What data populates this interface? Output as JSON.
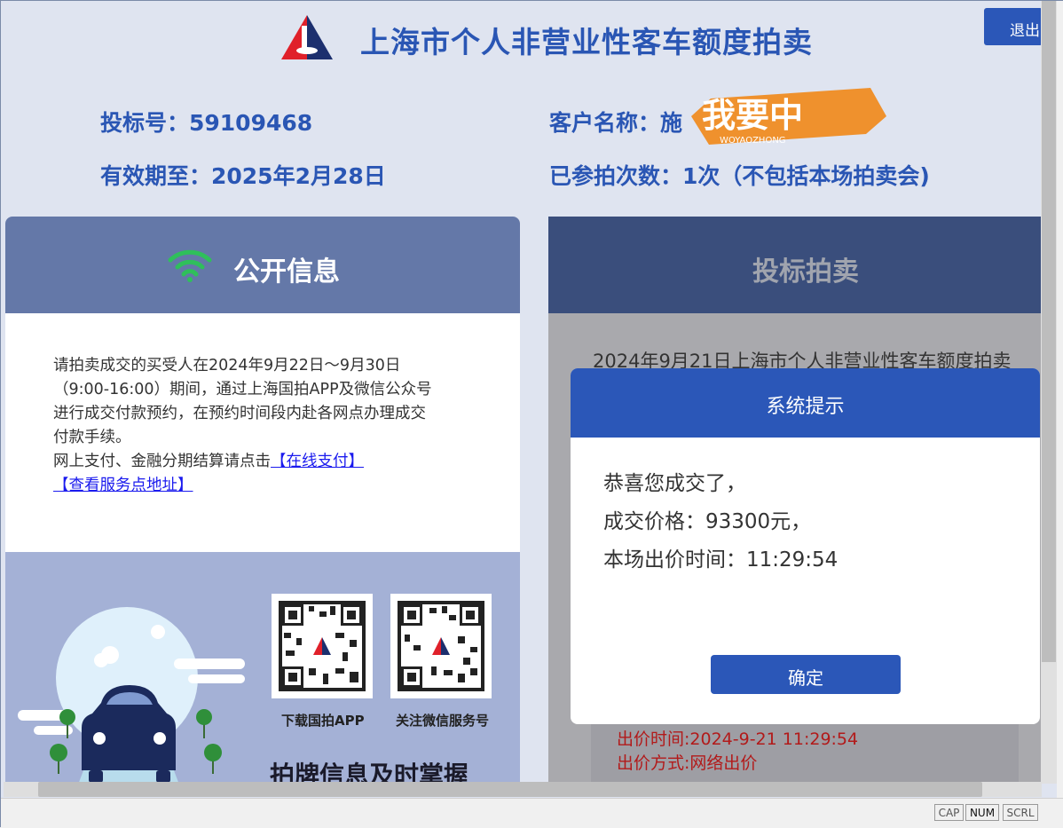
{
  "header": {
    "title": "上海市个人非营业性客车额度拍卖",
    "logout_label": "退出"
  },
  "info": {
    "bid_no": "投标号：59109468",
    "customer": "客户名称：施",
    "valid_until": "有效期至：2025年2月28日",
    "participations": "已参拍次数：1次（不包括本场拍卖会)",
    "stamp_text": "我要中",
    "stamp_sub": "WOYAOZHONG"
  },
  "public_info": {
    "title": "公开信息",
    "notice_lines": [
      "请拍卖成交的买受人在2024年9月22日～9月30日",
      "（9:00-16:00）期间，通过上海国拍APP及微信公众号",
      "进行成交付款预约，在预约时间段内赴各网点办理成交",
      "付款手续。",
      "网上支付、金融分期结算请点击"
    ],
    "link_pay": "【在线支付】",
    "link_service": "【查看服务点地址】",
    "qr_app_label": "下载国拍APP",
    "qr_wechat_label": "关注微信服务号",
    "promo_heading": "拍牌信息及时掌握"
  },
  "bidding": {
    "title": "投标拍卖",
    "auction_line": "2024年9月21日上海市个人非营业性客车额度拍卖",
    "bid_time": "出价时间:2024-9-21 11:29:54",
    "bid_method": "出价方式:网络出价"
  },
  "dialog": {
    "title": "系统提示",
    "line1": "恭喜您成交了，",
    "line2": "成交价格：93300元，",
    "line3": "本场出价时间：11:29:54",
    "ok_label": "确定"
  },
  "status_bar": {
    "cap": "CAP",
    "num": "NUM",
    "scrl": "SCRL"
  },
  "colors": {
    "brand_blue": "#2b57b8",
    "panel_header": "#6478a8",
    "wifi_green": "#2fbf5b",
    "stamp_orange": "#f08a1c",
    "bid_red": "#b21a1a"
  }
}
